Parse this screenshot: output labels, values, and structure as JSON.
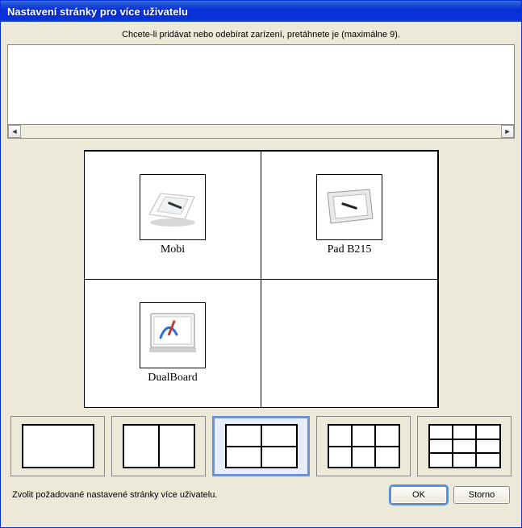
{
  "window": {
    "title": "Nastavení stránky pro více uživatelu"
  },
  "instruction": "Chcete-li pridávat nebo odebírat zarízení, pretáhnete je (maximálne 9).",
  "devices": {
    "mobi": {
      "label": "Mobi"
    },
    "padb215": {
      "label": "Pad B215"
    },
    "dualboard": {
      "label": "DualBoard"
    }
  },
  "layouts": {
    "selected_index": 2,
    "options": [
      {
        "cols": 1,
        "rows": 1
      },
      {
        "cols": 2,
        "rows": 1
      },
      {
        "cols": 2,
        "rows": 2
      },
      {
        "cols": 3,
        "rows": 2
      },
      {
        "cols": 3,
        "rows": 3
      }
    ]
  },
  "footer": {
    "hint": "Zvolit požadované nastavené stránky více uživatelu.",
    "ok_label": "OK",
    "cancel_label": "Storno"
  }
}
